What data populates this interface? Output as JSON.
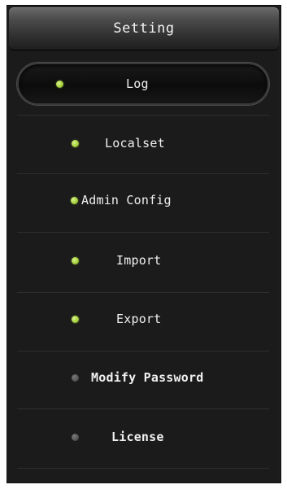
{
  "header": {
    "title": "Setting"
  },
  "menu": {
    "items": [
      {
        "label": "Log",
        "status": "active",
        "selected": true
      },
      {
        "label": "Localset",
        "status": "active",
        "selected": false
      },
      {
        "label": "Admin Config",
        "status": "active",
        "selected": false
      },
      {
        "label": "Import",
        "status": "active",
        "selected": false
      },
      {
        "label": "Export",
        "status": "active",
        "selected": false
      },
      {
        "label": "Modify Password",
        "status": "inactive",
        "selected": false
      },
      {
        "label": "License",
        "status": "inactive",
        "selected": false
      }
    ]
  },
  "colors": {
    "panel_background": "#1b1b1b",
    "active_indicator": "#a9d23f",
    "inactive_indicator": "#555555",
    "text": "#f0f0f0"
  }
}
